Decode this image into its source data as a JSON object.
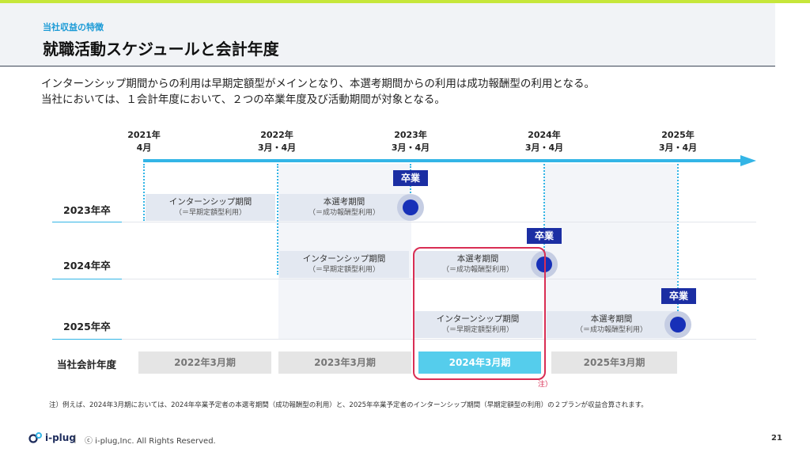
{
  "header": {
    "subtitle": "当社収益の特徴",
    "title": "就職活動スケジュールと会計年度"
  },
  "intro": {
    "line1": "インターンシップ期間からの利用は早期定額型がメインとなり、本選考期間からの利用は成功報酬型の利用となる。",
    "line2": "当社においては、１会計年度において、２つの卒業年度及び活動期間が対象となる。"
  },
  "timeline": {
    "years": [
      {
        "year": "2021年",
        "month": "4月"
      },
      {
        "year": "2022年",
        "month": "3月・4月"
      },
      {
        "year": "2023年",
        "month": "3月・4月"
      },
      {
        "year": "2024年",
        "month": "3月・4月"
      },
      {
        "year": "2025年",
        "month": "3月・4月"
      }
    ]
  },
  "rows": [
    {
      "label": "2023年卒"
    },
    {
      "label": "2024年卒"
    },
    {
      "label": "2025年卒"
    }
  ],
  "periods": {
    "intern_title": "インターンシップ期間",
    "intern_sub": "（＝早期定額型利用）",
    "main_title": "本選考期間",
    "main_sub": "（＝成功報酬型利用）"
  },
  "graduation_label": "卒業",
  "fiscal": {
    "label": "当社会計年度",
    "years": [
      "2022年3月期",
      "2023年3月期",
      "2024年3月期",
      "2025年3月期"
    ],
    "highlighted_index": 2
  },
  "note_mark": "注）",
  "footnote": "注）例えば、2024年3月期においては、2024年卒業予定者の本選考期間（成功報酬型の利用）と、2025年卒業予定者のインターンシップ期間（早期定額型の利用）の２プランが収益合算されます。",
  "footer": {
    "logo_text": "i-plug",
    "separator": "|",
    "copyright": "ⓒ i-plug,Inc. All Rights Reserved.",
    "page_number": "21"
  },
  "colors": {
    "accent_green": "#c6e63a",
    "timeline_blue": "#33b5e6",
    "navy": "#1b2ea3",
    "highlight": "#55cdec",
    "note_red": "#d92e54"
  }
}
